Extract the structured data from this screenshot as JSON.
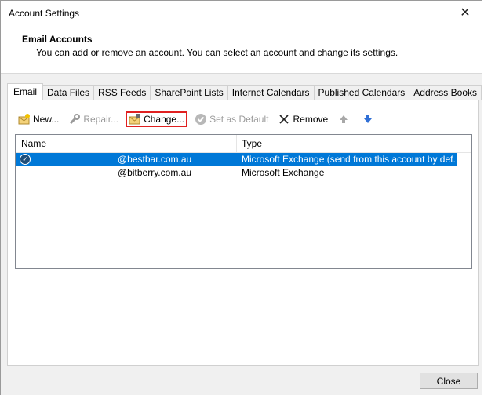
{
  "window": {
    "title": "Account Settings"
  },
  "header": {
    "title": "Email Accounts",
    "subtitle": "You can add or remove an account. You can select an account and change its settings."
  },
  "tabs": [
    {
      "label": "Email",
      "active": true
    },
    {
      "label": "Data Files"
    },
    {
      "label": "RSS Feeds"
    },
    {
      "label": "SharePoint Lists"
    },
    {
      "label": "Internet Calendars"
    },
    {
      "label": "Published Calendars"
    },
    {
      "label": "Address Books"
    }
  ],
  "toolbar": {
    "new_label": "New...",
    "repair_label": "Repair...",
    "change_label": "Change...",
    "set_default_label": "Set as Default",
    "remove_label": "Remove"
  },
  "accounts": {
    "columns": {
      "name": "Name",
      "type": "Type"
    },
    "rows": [
      {
        "name": "@bestbar.com.au",
        "type": "Microsoft Exchange (send from this account by def...",
        "selected": true,
        "default": true
      },
      {
        "name": "@bitberry.com.au",
        "type": "Microsoft Exchange",
        "selected": false,
        "default": false
      }
    ]
  },
  "footer": {
    "close_label": "Close"
  },
  "colors": {
    "selection": "#0078d7",
    "highlight_border": "#e02020",
    "dialog_bg": "#f0f0f0"
  }
}
